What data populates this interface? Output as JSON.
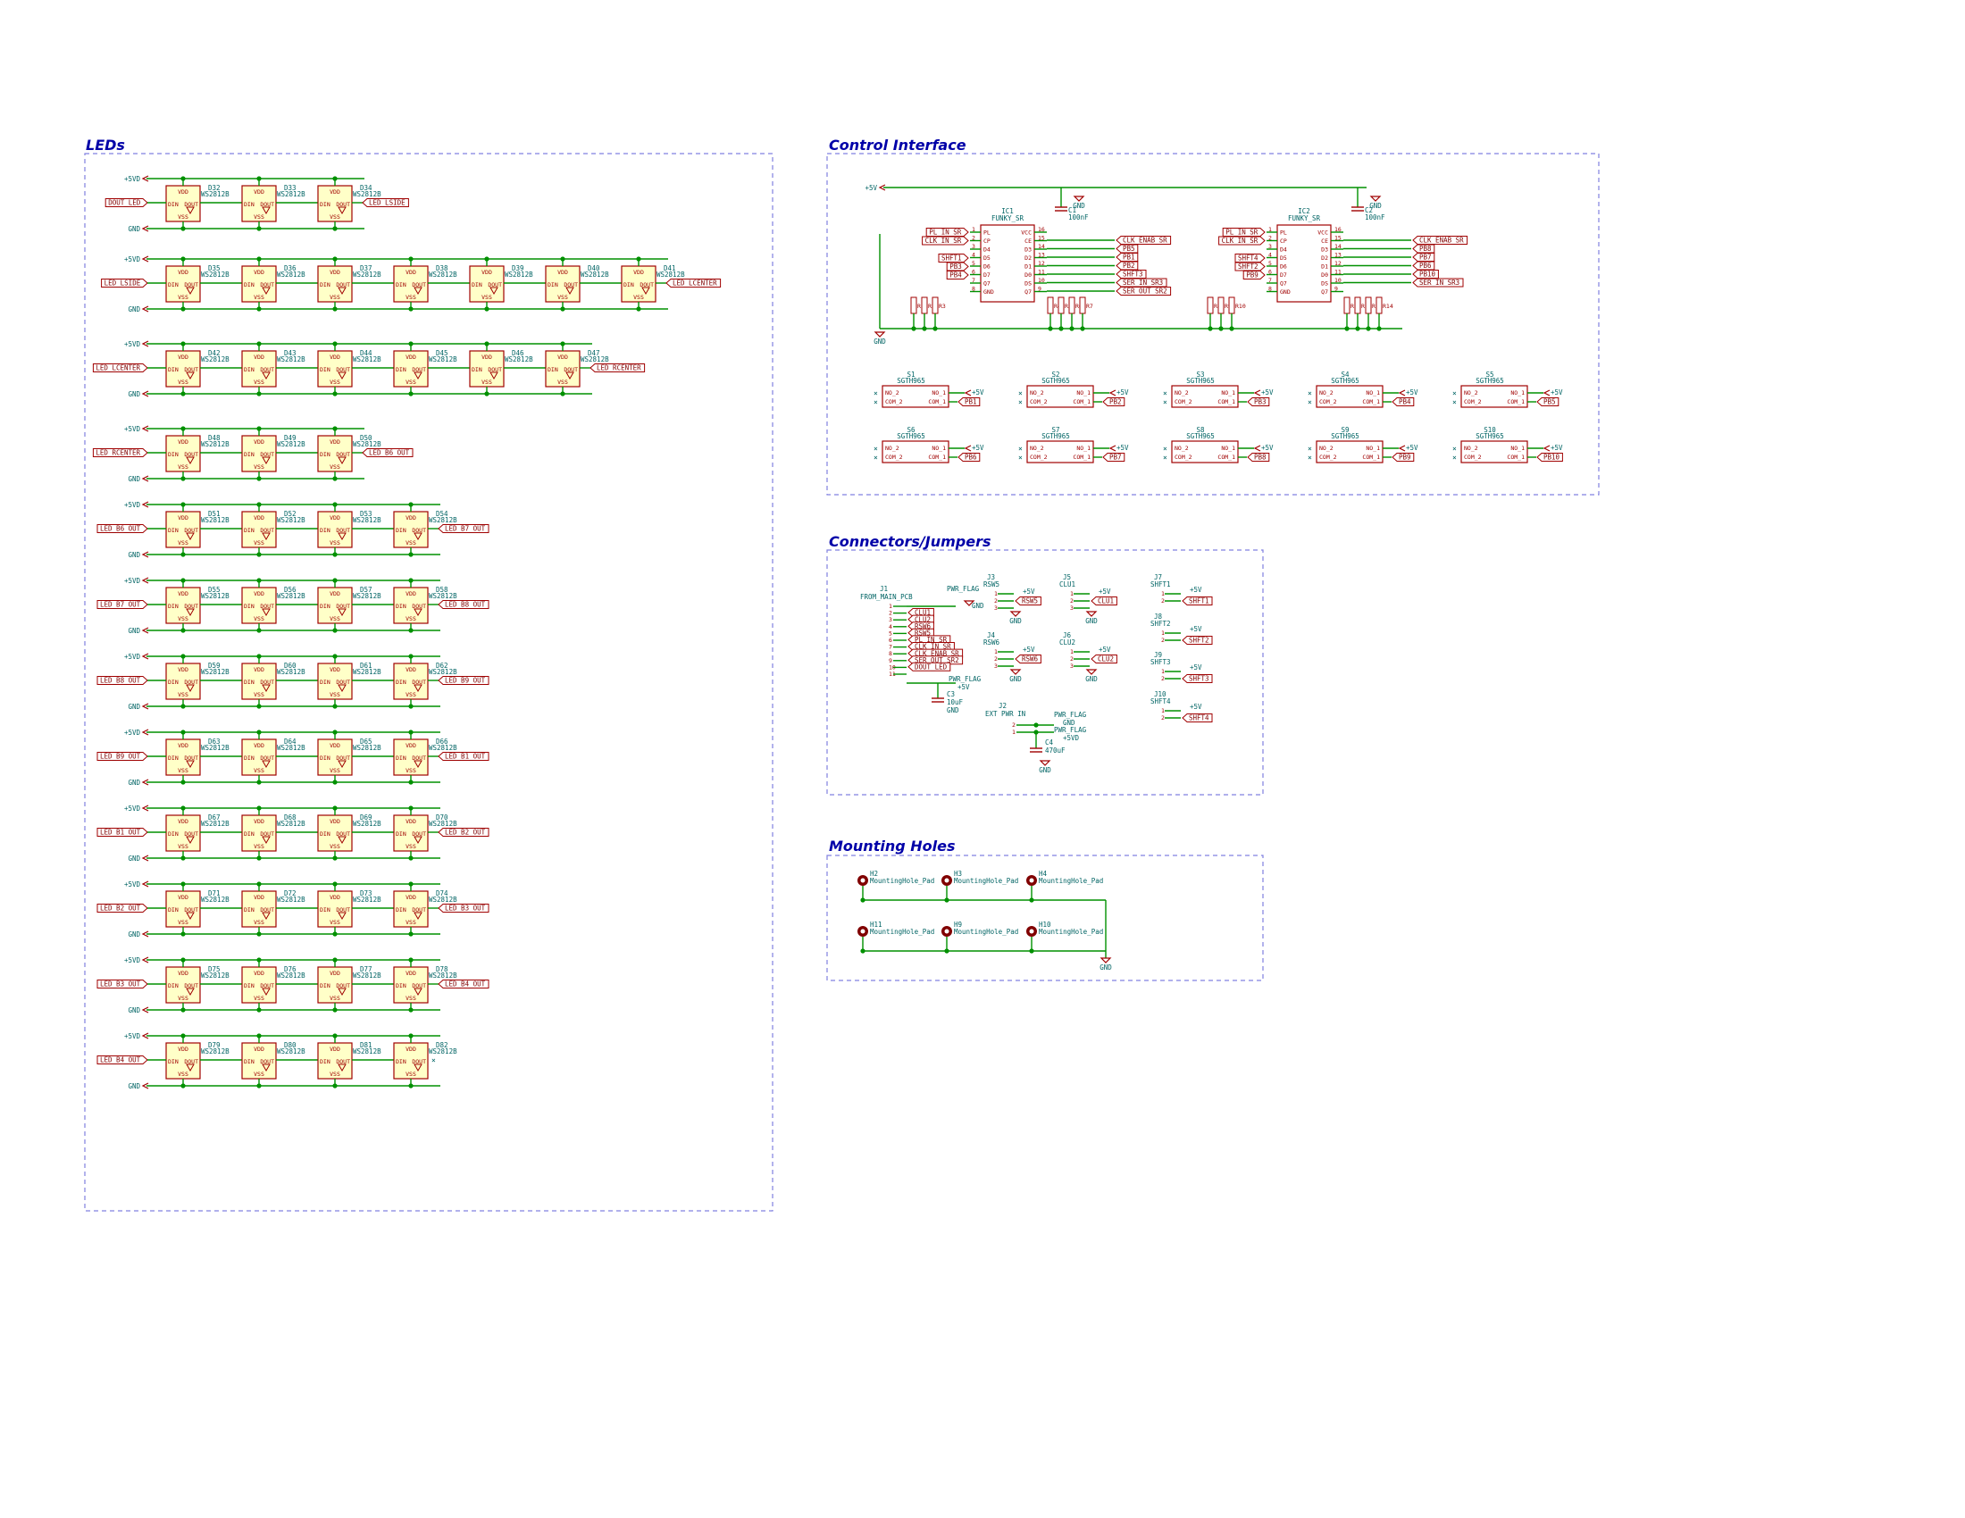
{
  "sections": {
    "leds": "LEDs",
    "control": "Control Interface",
    "connectors": "Connectors/Jumpers",
    "mounting": "Mounting Holes"
  },
  "power": {
    "v5": "+5VD",
    "gnd": "GND",
    "v5b": "+5V"
  },
  "led_part": "WS2812B",
  "led_pins": {
    "din": "DIN",
    "dout": "DOUT",
    "vdd": "VDD",
    "vss": "VSS"
  },
  "led_rows": [
    {
      "in": "DOUT_LED",
      "out": "LED_LSIDE",
      "ids": [
        "D32",
        "D33",
        "D34"
      ]
    },
    {
      "in": "LED_LSIDE",
      "out": "LED_LCENTER",
      "ids": [
        "D35",
        "D36",
        "D37",
        "D38",
        "D39",
        "D40",
        "D41"
      ]
    },
    {
      "in": "LED_LCENTER",
      "out": "LED_RCENTER",
      "ids": [
        "D42",
        "D43",
        "D44",
        "D45",
        "D46",
        "D47"
      ]
    },
    {
      "in": "LED_RCENTER",
      "out": "LED_B6_OUT",
      "ids": [
        "D48",
        "D49",
        "D50"
      ]
    },
    {
      "in": "LED_B6_OUT",
      "out": "LED_B7_OUT",
      "ids": [
        "D51",
        "D52",
        "D53",
        "D54"
      ]
    },
    {
      "in": "LED_B7_OUT",
      "out": "LED_B8_OUT",
      "ids": [
        "D55",
        "D56",
        "D57",
        "D58"
      ]
    },
    {
      "in": "LED_B8_OUT",
      "out": "LED_B9_OUT",
      "ids": [
        "D59",
        "D60",
        "D61",
        "D62"
      ]
    },
    {
      "in": "LED_B9_OUT",
      "out": "LED_B1_OUT",
      "ids": [
        "D63",
        "D64",
        "D65",
        "D66"
      ]
    },
    {
      "in": "LED_B1_OUT",
      "out": "LED_B2_OUT",
      "ids": [
        "D67",
        "D68",
        "D69",
        "D70"
      ]
    },
    {
      "in": "LED_B2_OUT",
      "out": "LED_B3_OUT",
      "ids": [
        "D71",
        "D72",
        "D73",
        "D74"
      ]
    },
    {
      "in": "LED_B3_OUT",
      "out": "LED_B4_OUT",
      "ids": [
        "D75",
        "D76",
        "D77",
        "D78"
      ]
    },
    {
      "in": "LED_B4_OUT",
      "out": "",
      "ids": [
        "D79",
        "D80",
        "D81",
        "D82"
      ]
    }
  ],
  "control": {
    "ics": [
      {
        "ref": "IC1",
        "part": "FUNKY_SR",
        "c_ref": "C1",
        "c_val": "100nF",
        "in_labels": [
          "PL_IN_SR",
          "CLK_IN_SR",
          "SHFT1",
          "PB3",
          "PB4"
        ],
        "out_labels": [
          "CLK_ENAB_SR",
          "PB5",
          "PB1",
          "PB2",
          "SHFT3",
          "SER_IN_SR3",
          "SER_OUT_SR2"
        ],
        "res_left": [
          "R1",
          "R2",
          "R3"
        ],
        "res_right": [
          "R4",
          "R5",
          "R6",
          "R7"
        ]
      },
      {
        "ref": "IC2",
        "part": "FUNKY_SR",
        "c_ref": "C2",
        "c_val": "100nF",
        "in_labels": [
          "PL_IN_SR",
          "CLK_IN_SR",
          "SHFT4",
          "SHFT2",
          "PB9"
        ],
        "out_labels": [
          "CLK_ENAB_SR",
          "PB8",
          "PB7",
          "PB6",
          "PB10",
          "SER_IN_SR3"
        ],
        "res_left": [
          "R8",
          "R9",
          "R10"
        ],
        "res_right": [
          "R11",
          "R12",
          "R13",
          "R14"
        ]
      }
    ],
    "ic_left_pins": [
      "PL",
      "CP",
      "D4",
      "D5",
      "D6",
      "D7",
      "Q7",
      "GND"
    ],
    "ic_right_pins": [
      "VCC",
      "CE",
      "D3",
      "D2",
      "D1",
      "D0",
      "DS",
      "Q7"
    ],
    "switch_part": "SGTH965",
    "switches": [
      {
        "ref": "S1",
        "label": "PB1"
      },
      {
        "ref": "S2",
        "label": "PB2"
      },
      {
        "ref": "S3",
        "label": "PB3"
      },
      {
        "ref": "S4",
        "label": "PB4"
      },
      {
        "ref": "S5",
        "label": "PB5"
      },
      {
        "ref": "S6",
        "label": "PB6"
      },
      {
        "ref": "S7",
        "label": "PB7"
      },
      {
        "ref": "S8",
        "label": "PB8"
      },
      {
        "ref": "S9",
        "label": "PB9"
      },
      {
        "ref": "S10",
        "label": "PB10"
      }
    ],
    "sw_pins": [
      "NO_2",
      "COM_2",
      "NO_1",
      "COM_1"
    ]
  },
  "connectors": {
    "j1": {
      "ref": "J1",
      "name": "FROM_MAIN_PCB",
      "pins": [
        "CLU1",
        "CLU2",
        "RSW6",
        "RSW5",
        "PL_IN_SR",
        "CLK_IN_SR",
        "CLK_ENAB_SR",
        "SER_OUT_SR2",
        "DOUT_LED"
      ]
    },
    "pwr_flag": "PWR_FLAG",
    "j3": {
      "ref": "J3",
      "name": "RSW5",
      "label": "RSW5"
    },
    "j4": {
      "ref": "J4",
      "name": "RSW6",
      "label": "RSW6"
    },
    "j5": {
      "ref": "J5",
      "name": "CLU1",
      "label": "CLU1"
    },
    "j6": {
      "ref": "J6",
      "name": "CLU2",
      "label": "CLU2"
    },
    "j7": {
      "ref": "J7",
      "name": "SHFT1",
      "label": "SHFT1"
    },
    "j8": {
      "ref": "J8",
      "name": "SHFT2",
      "label": "SHFT2"
    },
    "j9": {
      "ref": "J9",
      "name": "SHFT3",
      "label": "SHFT3"
    },
    "j10": {
      "ref": "J10",
      "name": "SHFT4",
      "label": "SHFT4"
    },
    "j2": {
      "ref": "J2",
      "name": "EXT PWR IN"
    },
    "c3": {
      "ref": "C3",
      "val": "10uF"
    },
    "c4": {
      "ref": "C4",
      "val": "470uF"
    }
  },
  "mounting": {
    "part": "MountingHole_Pad",
    "holes": [
      "H2",
      "H3",
      "H4",
      "H11",
      "H9",
      "H10"
    ]
  }
}
